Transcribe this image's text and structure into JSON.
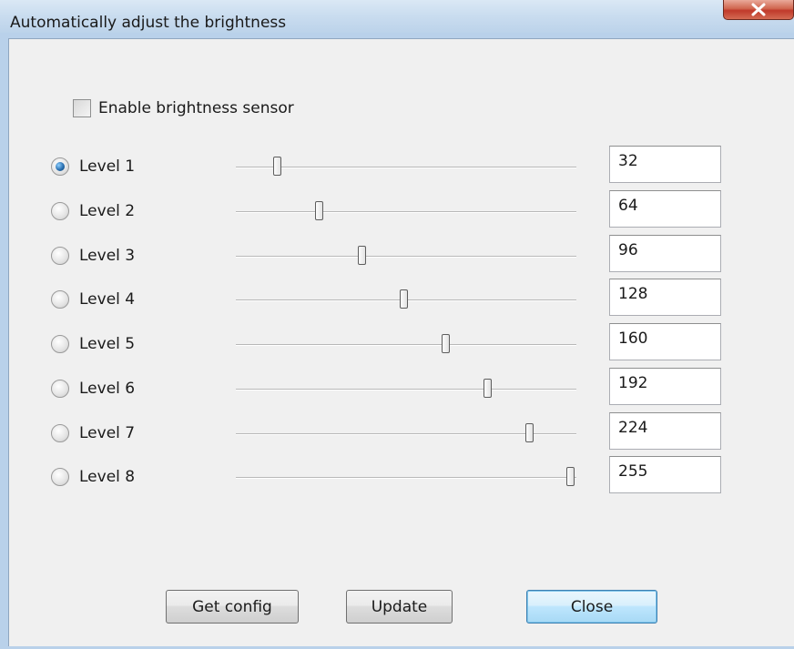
{
  "window": {
    "title": "Automatically adjust the brightness"
  },
  "sensor": {
    "label": "Enable brightness sensor",
    "checked": false
  },
  "levels": [
    {
      "label": "Level 1",
      "value": "32",
      "slider_fraction": 0.125,
      "selected": true
    },
    {
      "label": "Level 2",
      "value": "64",
      "slider_fraction": 0.251,
      "selected": false
    },
    {
      "label": "Level 3",
      "value": "96",
      "slider_fraction": 0.376,
      "selected": false
    },
    {
      "label": "Level 4",
      "value": "128",
      "slider_fraction": 0.502,
      "selected": false
    },
    {
      "label": "Level 5",
      "value": "160",
      "slider_fraction": 0.627,
      "selected": false
    },
    {
      "label": "Level 6",
      "value": "192",
      "slider_fraction": 0.753,
      "selected": false
    },
    {
      "label": "Level 7",
      "value": "224",
      "slider_fraction": 0.878,
      "selected": false
    },
    {
      "label": "Level 8",
      "value": "255",
      "slider_fraction": 1.0,
      "selected": false
    }
  ],
  "buttons": {
    "get_config": "Get config",
    "update": "Update",
    "close": "Close"
  },
  "icons": {
    "titlebar_close": "close-icon"
  },
  "colors": {
    "close_button_red": "#c0392b",
    "radio_selected_blue": "#2a6fb0",
    "default_button_blue": "#3c7fb1"
  }
}
